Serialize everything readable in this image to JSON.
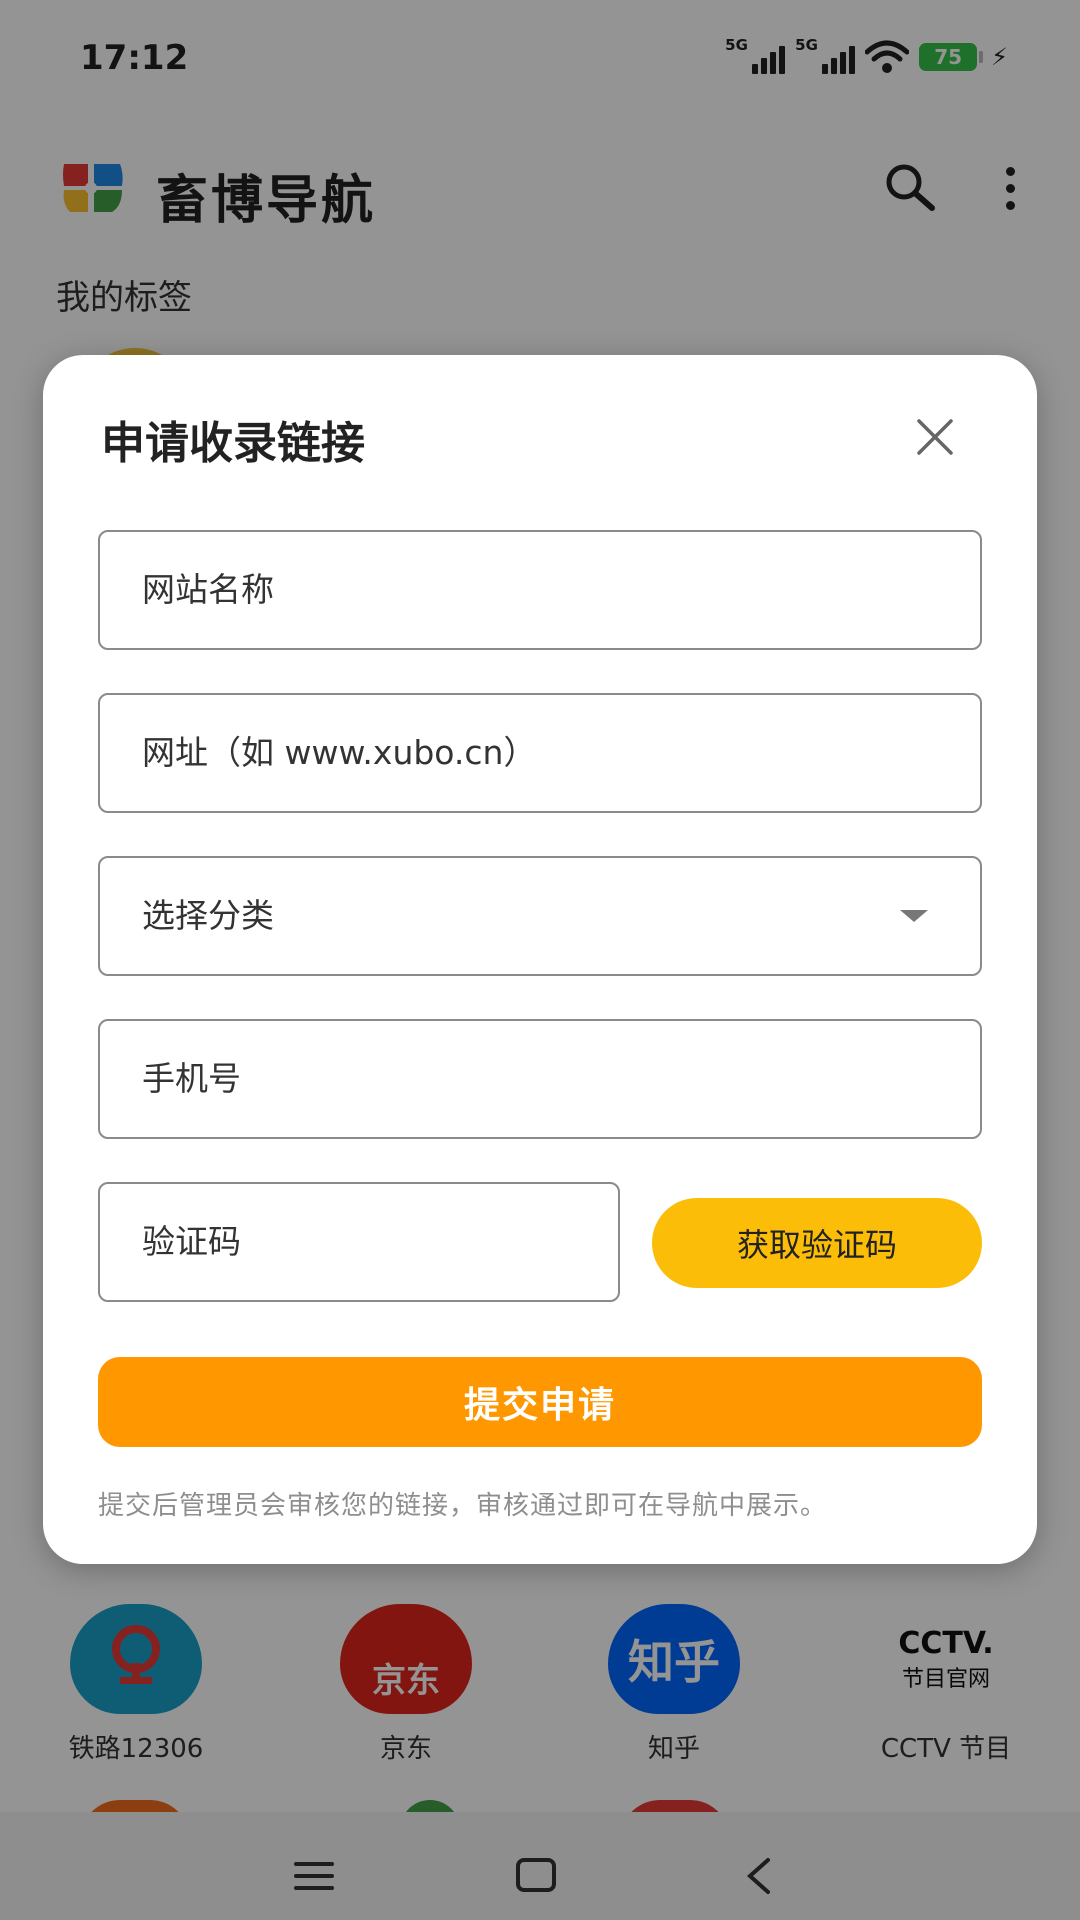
{
  "status_bar": {
    "time": "17:12",
    "sim1_label": "5G",
    "sim2_label": "5G",
    "battery": "75"
  },
  "header": {
    "app_title": "畜博导航",
    "section_title": "我的标签"
  },
  "shortcuts": [
    {
      "label": "铁路12306",
      "icon_text": "中国铁路",
      "color": "#1aa0c8"
    },
    {
      "label": "京东",
      "icon_text": "京东",
      "color": "#e1251b"
    },
    {
      "label": "知乎",
      "icon_text": "知乎",
      "color": "#0066ff"
    },
    {
      "label": "CCTV 节目",
      "icon_text": "CCTV.",
      "icon_subtext": "节目官网",
      "color": "#ffffff"
    }
  ],
  "dialog": {
    "title": "申请收录链接",
    "site_name_placeholder": "网站名称",
    "url_placeholder": "网址（如 www.xubo.cn）",
    "category_placeholder": "选择分类",
    "phone_placeholder": "手机号",
    "code_placeholder": "验证码",
    "get_code_label": "获取验证码",
    "submit_label": "提交申请",
    "hint": "提交后管理员会审核您的链接，审核通过即可在导航中展示。"
  },
  "colors": {
    "accent_orange": "#ff9800",
    "accent_yellow": "#fbbd08",
    "battery_green": "#35c24a"
  }
}
